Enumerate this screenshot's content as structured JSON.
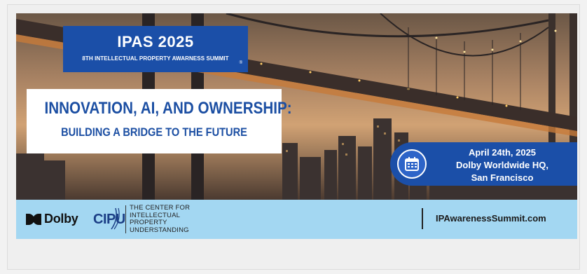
{
  "logo": {
    "title": "IPAS 2025",
    "subtitle": "8TH INTELLECTUAL PROPERTY AWARNESS SUMMIT",
    "reg_mark": "®"
  },
  "headline": {
    "line1": "INNOVATION, AI, AND OWNERSHIP:",
    "line2": "BUILDING A BRIDGE TO THE FUTURE"
  },
  "event": {
    "date": "April 24th, 2025",
    "venue": "Dolby Worldwide HQ,",
    "city": "San Francisco",
    "icon": "calendar-icon"
  },
  "footer": {
    "dolby_label": "Dolby",
    "cipu_label": "CIPU",
    "center_lines": [
      "THE CENTER FOR",
      "INTELLECTUAL",
      "PROPERTY",
      "UNDERSTANDING"
    ],
    "website": "IPAwarenessSummit.com"
  },
  "colors": {
    "brand_blue": "#1b4fa8",
    "footer_bg": "#a3d7f2",
    "headline_blue": "#1c4fa3"
  }
}
